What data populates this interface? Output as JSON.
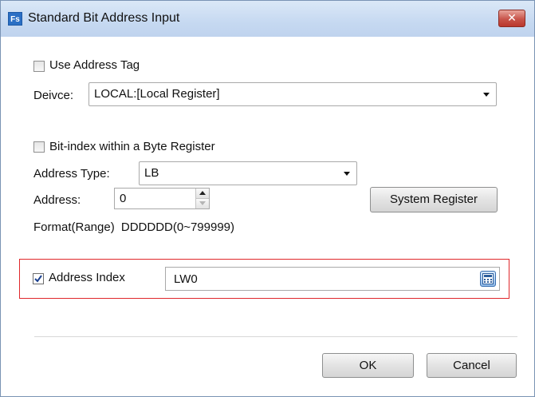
{
  "window": {
    "title": "Standard Bit Address Input",
    "app_icon_text": "Fs",
    "close_icon": "close-icon"
  },
  "use_address_tag": {
    "label": "Use Address Tag",
    "checked": false
  },
  "device": {
    "label": "Deivce:",
    "value": "LOCAL:[Local Register]"
  },
  "bit_index": {
    "label": "Bit-index within a Byte Register",
    "checked": false
  },
  "address_type": {
    "label": "Address Type:",
    "value": "LB"
  },
  "address": {
    "label": "Address:",
    "value": "0"
  },
  "system_register_button": "System Register",
  "format": {
    "label": "Format(Range)",
    "value": "DDDDDD(0~799999)"
  },
  "address_index": {
    "label": "Address Index",
    "checked": true,
    "value": "LW0",
    "highlight_color": "#e0272b"
  },
  "buttons": {
    "ok": "OK",
    "cancel": "Cancel"
  }
}
